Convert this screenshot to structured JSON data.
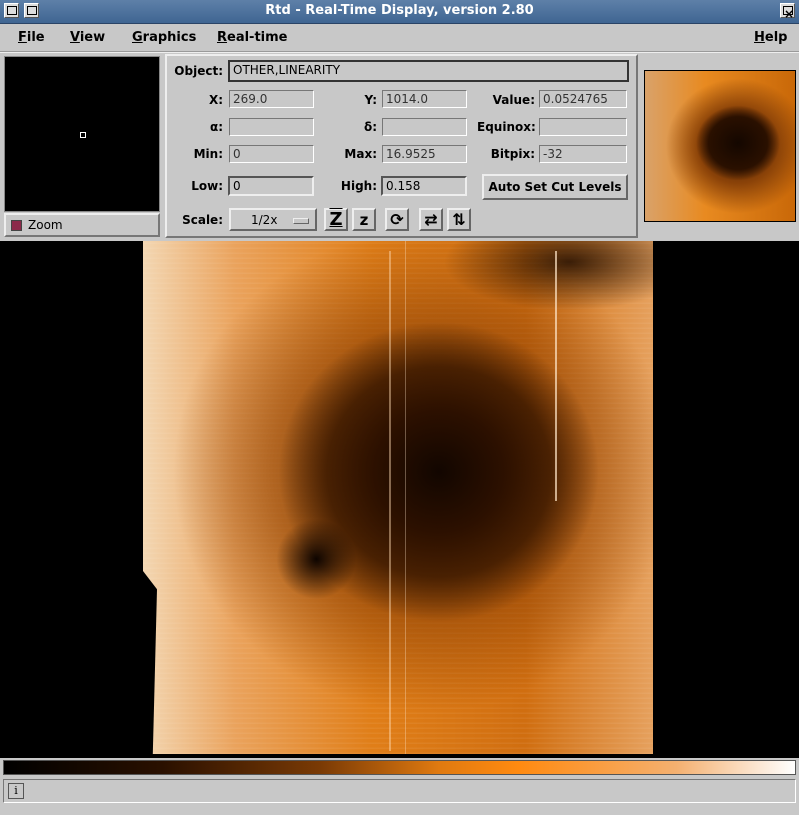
{
  "window": {
    "title": "Rtd - Real-Time Display, version 2.80",
    "close_glyph": "×"
  },
  "menubar": {
    "items": [
      "File",
      "View",
      "Graphics",
      "Real-time"
    ],
    "help": "Help"
  },
  "zoom": {
    "label": "Zoom"
  },
  "info": {
    "object_label": "Object:",
    "object_value": "OTHER,LINEARITY",
    "x_label": "X:",
    "x_value": "269.0",
    "y_label": "Y:",
    "y_value": "1014.0",
    "value_label": "Value:",
    "value_value": "0.0524765",
    "alpha_label": "α:",
    "alpha_value": "",
    "delta_label": "δ:",
    "delta_value": "",
    "equinox_label": "Equinox:",
    "equinox_value": "",
    "min_label": "Min:",
    "min_value": "0",
    "max_label": "Max:",
    "max_value": "16.9525",
    "bitpix_label": "Bitpix:",
    "bitpix_value": "-32",
    "low_label": "Low:",
    "low_value": "0",
    "high_label": "High:",
    "high_value": "0.158",
    "auto_cut_label": "Auto Set Cut Levels",
    "scale_label": "Scale:",
    "scale_value": "1/2x"
  },
  "tools": {
    "zoom_in_glyph": "Z",
    "zoom_out_glyph": "z",
    "rotate_glyph": "⟳",
    "flip_x_glyph": "⇄",
    "flip_y_glyph": "⇅"
  },
  "status": {
    "info_icon": "i",
    "message": ""
  },
  "colors": {
    "title_bar": "#3f6592",
    "image_accent": "#e07e18",
    "zoom_indicator": "#8c2a4a"
  }
}
